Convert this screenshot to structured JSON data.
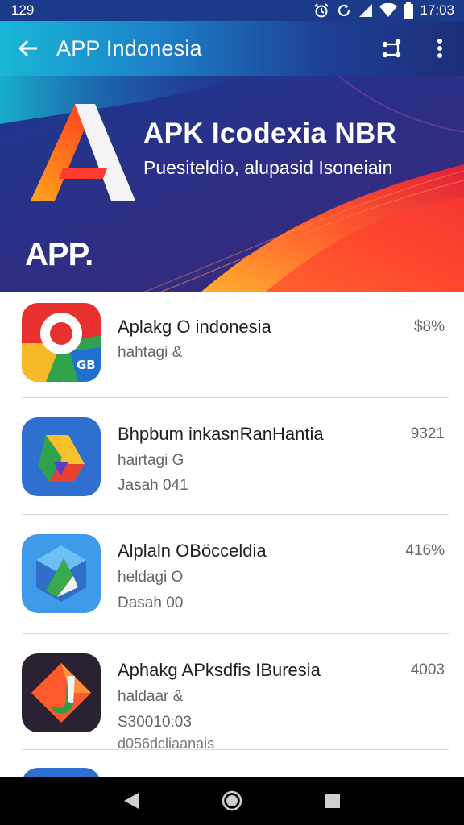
{
  "status_bar": {
    "left_text": "129",
    "time": "17:03"
  },
  "app_bar": {
    "title": "APP Indonesia"
  },
  "hero": {
    "title": "APK Icodexia NBR",
    "subtitle": "Puesiteldio, alupasid Isoneiain",
    "app_text": "APP."
  },
  "apps": [
    {
      "name": "Aplakg O indonesia",
      "line2": "hahtagi &",
      "line3": "",
      "line4": "",
      "value": "$8%"
    },
    {
      "name": "Bhpbum inkasnRanHantia",
      "line2": "hairtagi G",
      "line3": "Jasah 041",
      "line4": "",
      "value": "9321"
    },
    {
      "name": "Alplaln OBöcceldia",
      "line2": "heldagi O",
      "line3": "Dasah 00",
      "line4": "",
      "value": "416%"
    },
    {
      "name": "Aphakg APksdfis IBuresia",
      "line2": "haldaar &",
      "line3": "S30010:03",
      "line4": "d056dcliaanais",
      "value": "4003"
    }
  ],
  "icons": {
    "status": [
      "alarm-icon",
      "sync-icon",
      "signal-icon",
      "wifi-icon",
      "battery-icon"
    ],
    "app_bar": [
      "back-arrow-icon",
      "share-icon",
      "more-vert-icon"
    ],
    "nav": [
      "back-triangle-icon",
      "home-circle-icon",
      "recents-square-icon"
    ]
  },
  "colors": {
    "app_bar_start": "#19b7d8",
    "app_bar_end": "#1d2e7a",
    "hero_bg": "#2c2f86",
    "accent_orange": "#ff6a2b"
  }
}
